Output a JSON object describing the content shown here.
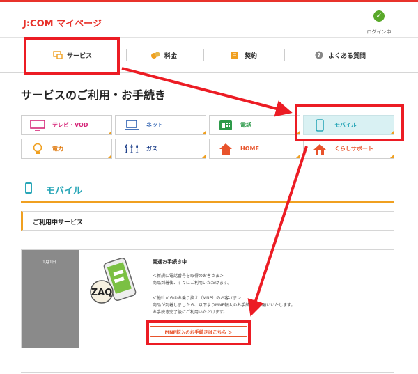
{
  "header": {
    "logo": "J:COM マイページ",
    "login_label": "ログイン中"
  },
  "nav": {
    "items": [
      {
        "label": "サービス",
        "icon": "tv-monitor-icon"
      },
      {
        "label": "料金",
        "icon": "coins-icon"
      },
      {
        "label": "契約",
        "icon": "document-pen-icon"
      },
      {
        "label": "よくある質問",
        "icon": "question-icon"
      }
    ]
  },
  "page_title": "サービスのご利用・お手続き",
  "services": [
    {
      "label": "テレビ・VOD",
      "icon": "tv-icon"
    },
    {
      "label": "ネット",
      "icon": "laptop-icon"
    },
    {
      "label": "電話",
      "icon": "phone-icon"
    },
    {
      "label": "モバイル",
      "icon": "smartphone-icon"
    },
    {
      "label": "電力",
      "icon": "lightbulb-icon"
    },
    {
      "label": "ガス",
      "icon": "gas-flame-icon"
    },
    {
      "label": "HOME",
      "icon": "house-icon"
    },
    {
      "label": "くらしサポート",
      "icon": "support-icon"
    }
  ],
  "mobile_section": {
    "title": "モバイル",
    "in_use_label": "ご利用中サービス"
  },
  "card": {
    "date": "1月1日",
    "status": "開通お手続き中",
    "new_number_heading": "＜新規に電話番号を取得のお客さま＞",
    "new_number_body": "商品到着後、すぐにご利用いただけます。",
    "mnp_heading": "＜他社からのお乗り換え（MNP）のお客さま＞",
    "mnp_body": "商品が到着しましたら、以下よりMNP転入のお手続きをお願いいたします。",
    "mnp_body2": "お手続き完了後にご利用いただけます。",
    "mnp_button": "MNP転入のお手続きはこちら ＞"
  },
  "colors": {
    "brand": "#e8322b",
    "mobile_accent": "#2aa7b8",
    "tile_corner": "#f0a020",
    "highlight": "#ec1c24"
  }
}
